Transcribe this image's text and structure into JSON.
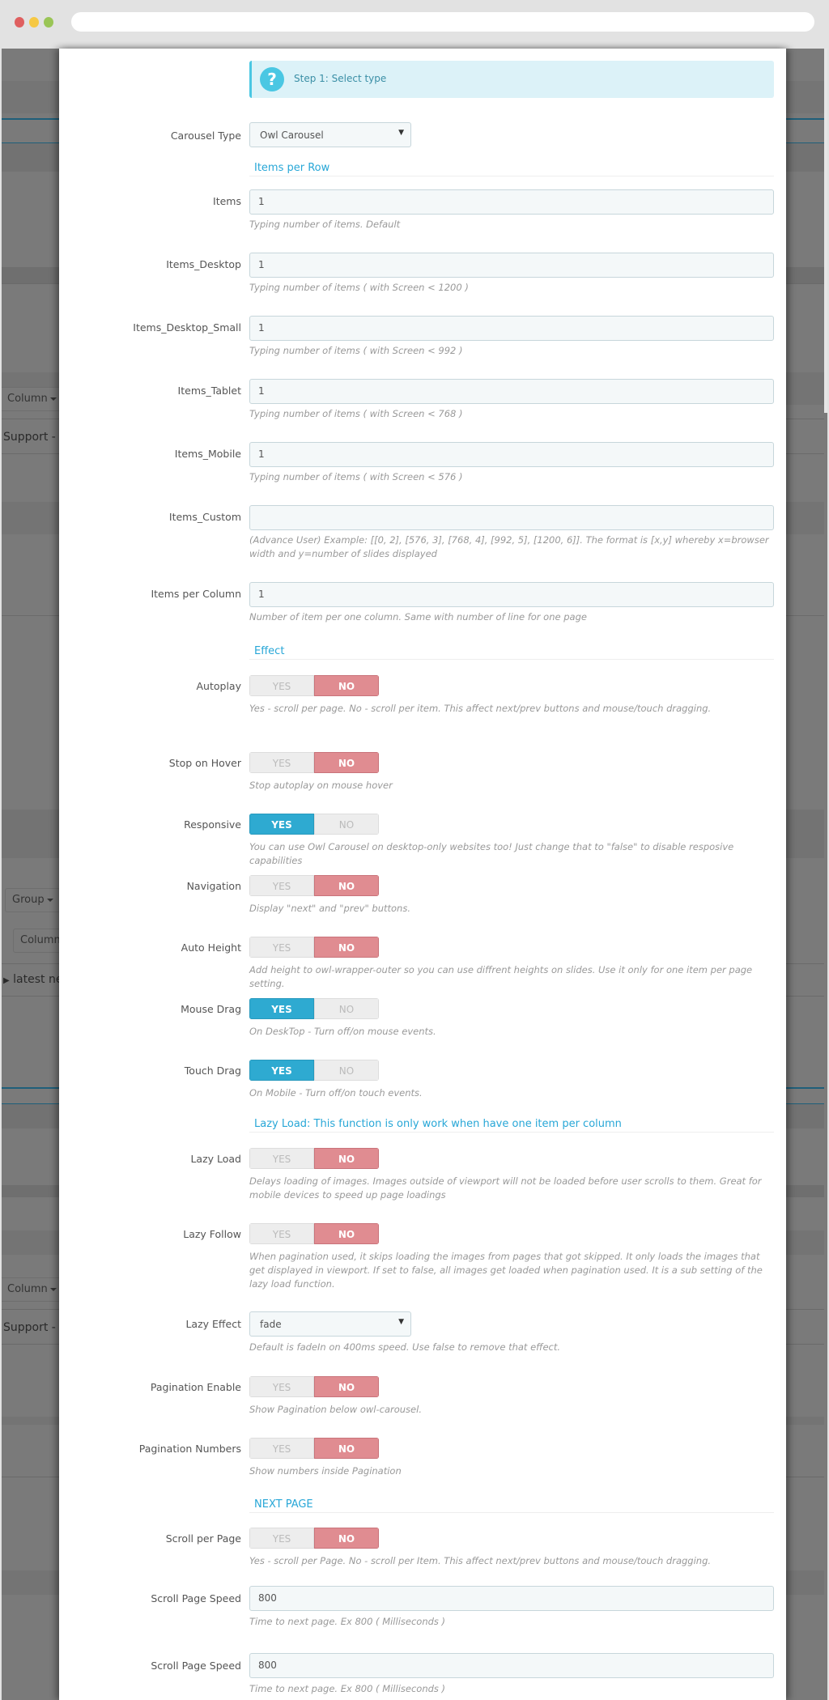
{
  "background": {
    "buttons": [
      {
        "label": "Column",
        "top": true
      },
      {
        "label": "Group"
      },
      {
        "label": "Column"
      },
      {
        "label": "Column"
      }
    ],
    "texts": [
      "Support - E",
      "latest ne",
      "Support - E"
    ]
  },
  "alert": {
    "icon": "question-circle-icon",
    "text": "Step 1: Select type"
  },
  "carousel_type": {
    "label": "Carousel Type",
    "value": "Owl Carousel"
  },
  "sections": {
    "items_per_row": "Items per Row",
    "effect": "Effect",
    "lazy_load": "Lazy Load: This function is only work when have one item per column",
    "next_page": "NEXT PAGE"
  },
  "fields": {
    "items": {
      "label": "Items",
      "value": "1",
      "help": "Typing number of items. Default"
    },
    "items_desktop": {
      "label": "Items_Desktop",
      "value": "1",
      "help": "Typing number of items ( with Screen < 1200 )"
    },
    "items_desktop_small": {
      "label": "Items_Desktop_Small",
      "value": "1",
      "help": "Typing number of items ( with Screen < 992 )"
    },
    "items_tablet": {
      "label": "Items_Tablet",
      "value": "1",
      "help": "Typing number of items ( with Screen < 768 )"
    },
    "items_mobile": {
      "label": "Items_Mobile",
      "value": "1",
      "help": "Typing number of items ( with Screen < 576 )"
    },
    "items_custom": {
      "label": "Items_Custom",
      "value": "",
      "help": "(Advance User) Example: [[0, 2], [576, 3], [768, 4], [992, 5], [1200, 6]]. The format is [x,y] whereby x=browser width and y=number of slides displayed"
    },
    "items_per_column": {
      "label": "Items per Column",
      "value": "1",
      "help": "Number of item per one column. Same with number of line for one page"
    },
    "lazy_effect": {
      "label": "Lazy Effect",
      "value": "fade",
      "help": "Default is fadeIn on 400ms speed. Use false to remove that effect."
    },
    "scroll_page_speed_1": {
      "label": "Scroll Page Speed",
      "value": "800",
      "help": "Time to next page. Ex 800 ( Milliseconds )"
    },
    "scroll_page_speed_2": {
      "label": "Scroll Page Speed",
      "value": "800",
      "help": "Time to next page. Ex 800 ( Milliseconds )"
    }
  },
  "toggle_labels": {
    "yes": "YES",
    "no": "NO"
  },
  "toggles": {
    "autoplay": {
      "label": "Autoplay",
      "value": "NO",
      "help": "Yes - scroll per page. No - scroll per item. This affect next/prev buttons and mouse/touch dragging."
    },
    "stop_on_hover": {
      "label": "Stop on Hover",
      "value": "NO",
      "help": "Stop autoplay on mouse hover"
    },
    "responsive": {
      "label": "Responsive",
      "value": "YES",
      "help": "You can use Owl Carousel on desktop-only websites too! Just change that to \"false\" to disable resposive capabilities"
    },
    "navigation": {
      "label": "Navigation",
      "value": "NO",
      "help": "Display \"next\" and \"prev\" buttons."
    },
    "auto_height": {
      "label": "Auto Height",
      "value": "NO",
      "help": "Add height to owl-wrapper-outer so you can use diffrent heights on slides. Use it only for one item per page setting."
    },
    "mouse_drag": {
      "label": "Mouse Drag",
      "value": "YES",
      "help": "On DeskTop - Turn off/on mouse events."
    },
    "touch_drag": {
      "label": "Touch Drag",
      "value": "YES",
      "help": "On Mobile - Turn off/on touch events."
    },
    "lazy_load": {
      "label": "Lazy Load",
      "value": "NO",
      "help": "Delays loading of images. Images outside of viewport will not be loaded before user scrolls to them. Great for mobile devices to speed up page loadings"
    },
    "lazy_follow": {
      "label": "Lazy Follow",
      "value": "NO",
      "help": "When pagination used, it skips loading the images from pages that got skipped. It only loads the images that get displayed in viewport. If set to false, all images get loaded when pagination used. It is a sub setting of the lazy load function."
    },
    "pagination_enable": {
      "label": "Pagination Enable",
      "value": "NO",
      "help": "Show Pagination below owl-carousel."
    },
    "pagination_numbers": {
      "label": "Pagination Numbers",
      "value": "NO",
      "help": "Show numbers inside Pagination"
    },
    "scroll_per_page": {
      "label": "Scroll per Page",
      "value": "NO",
      "help": "Yes - scroll per Page. No - scroll per Item. This affect next/prev buttons and mouse/touch dragging."
    }
  },
  "colors": {
    "accent": "#2eaad1",
    "no_active": "#e08c91",
    "section_title": "#28a7d7",
    "alert_bg": "#dcf2f8"
  }
}
